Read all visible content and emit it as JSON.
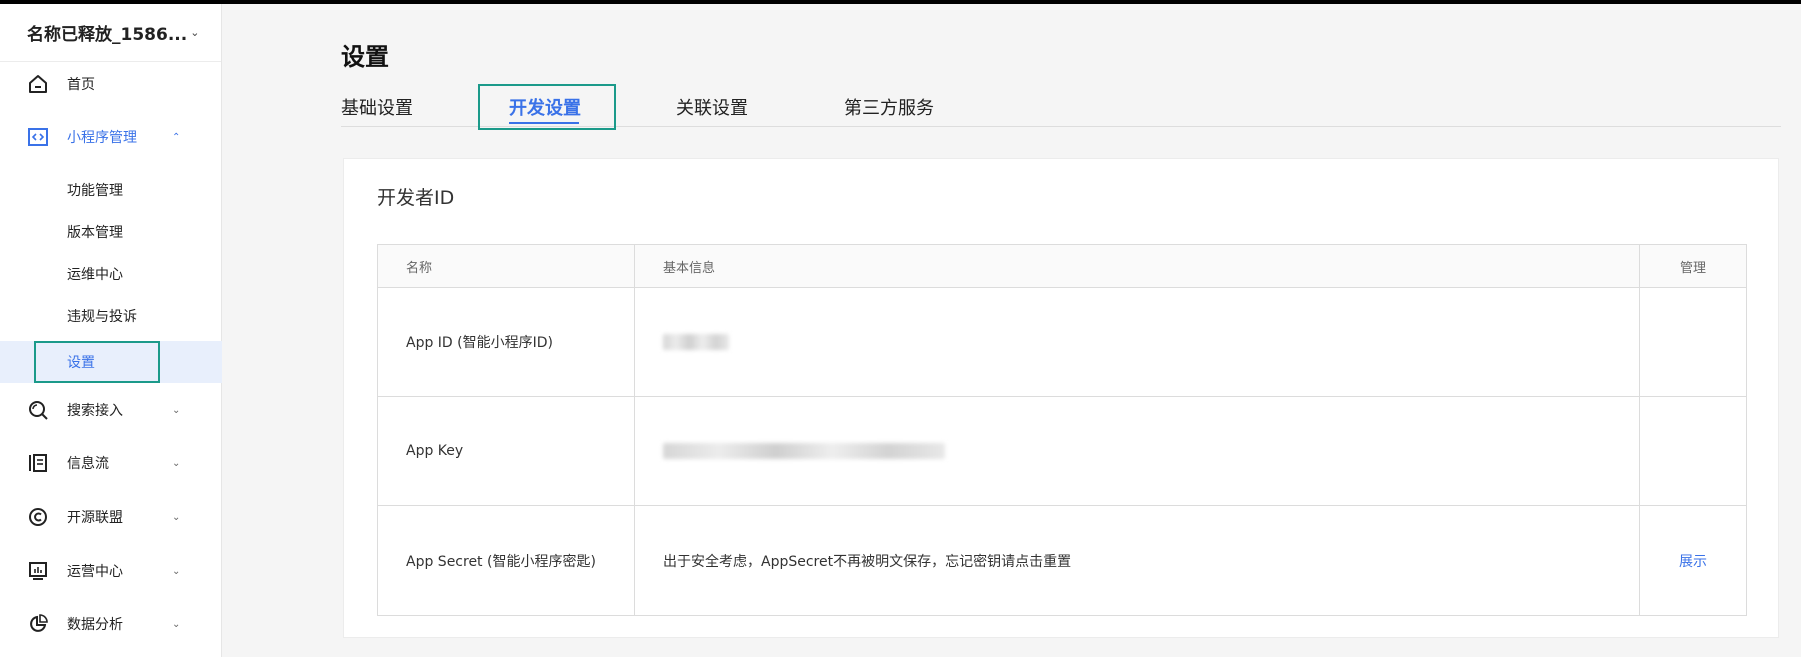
{
  "sidebar": {
    "account_name": "名称已释放_1586...",
    "items": [
      {
        "label": "首页",
        "icon": "home-icon"
      },
      {
        "label": "小程序管理",
        "icon": "code-icon",
        "expanded": true
      },
      {
        "label": "搜索接入",
        "icon": "search-icon"
      },
      {
        "label": "信息流",
        "icon": "feed-icon"
      },
      {
        "label": "开源联盟",
        "icon": "copyright-icon"
      },
      {
        "label": "运营中心",
        "icon": "dashboard-icon"
      },
      {
        "label": "数据分析",
        "icon": "pie-chart-icon"
      }
    ],
    "sub_items": [
      {
        "label": "功能管理"
      },
      {
        "label": "版本管理"
      },
      {
        "label": "运维中心"
      },
      {
        "label": "违规与投诉"
      },
      {
        "label": "设置",
        "selected": true
      }
    ]
  },
  "main": {
    "title": "设置",
    "tabs": [
      {
        "label": "基础设置"
      },
      {
        "label": "开发设置",
        "active": true
      },
      {
        "label": "关联设置"
      },
      {
        "label": "第三方服务"
      }
    ],
    "card": {
      "title": "开发者ID",
      "table": {
        "headers": [
          "名称",
          "基本信息",
          "管理"
        ],
        "rows": [
          {
            "name": "App ID (智能小程序ID)",
            "info": "",
            "action": ""
          },
          {
            "name": "App Key",
            "info": "",
            "action": ""
          },
          {
            "name": "App Secret (智能小程序密匙)",
            "info": "出于安全考虑，AppSecret不再被明文保存，忘记密钥请点击重置",
            "action": "展示"
          }
        ]
      }
    }
  },
  "colors": {
    "accent": "#3a72e8",
    "highlight_box": "#1b9a8a",
    "selected_bg": "#e8effc"
  }
}
